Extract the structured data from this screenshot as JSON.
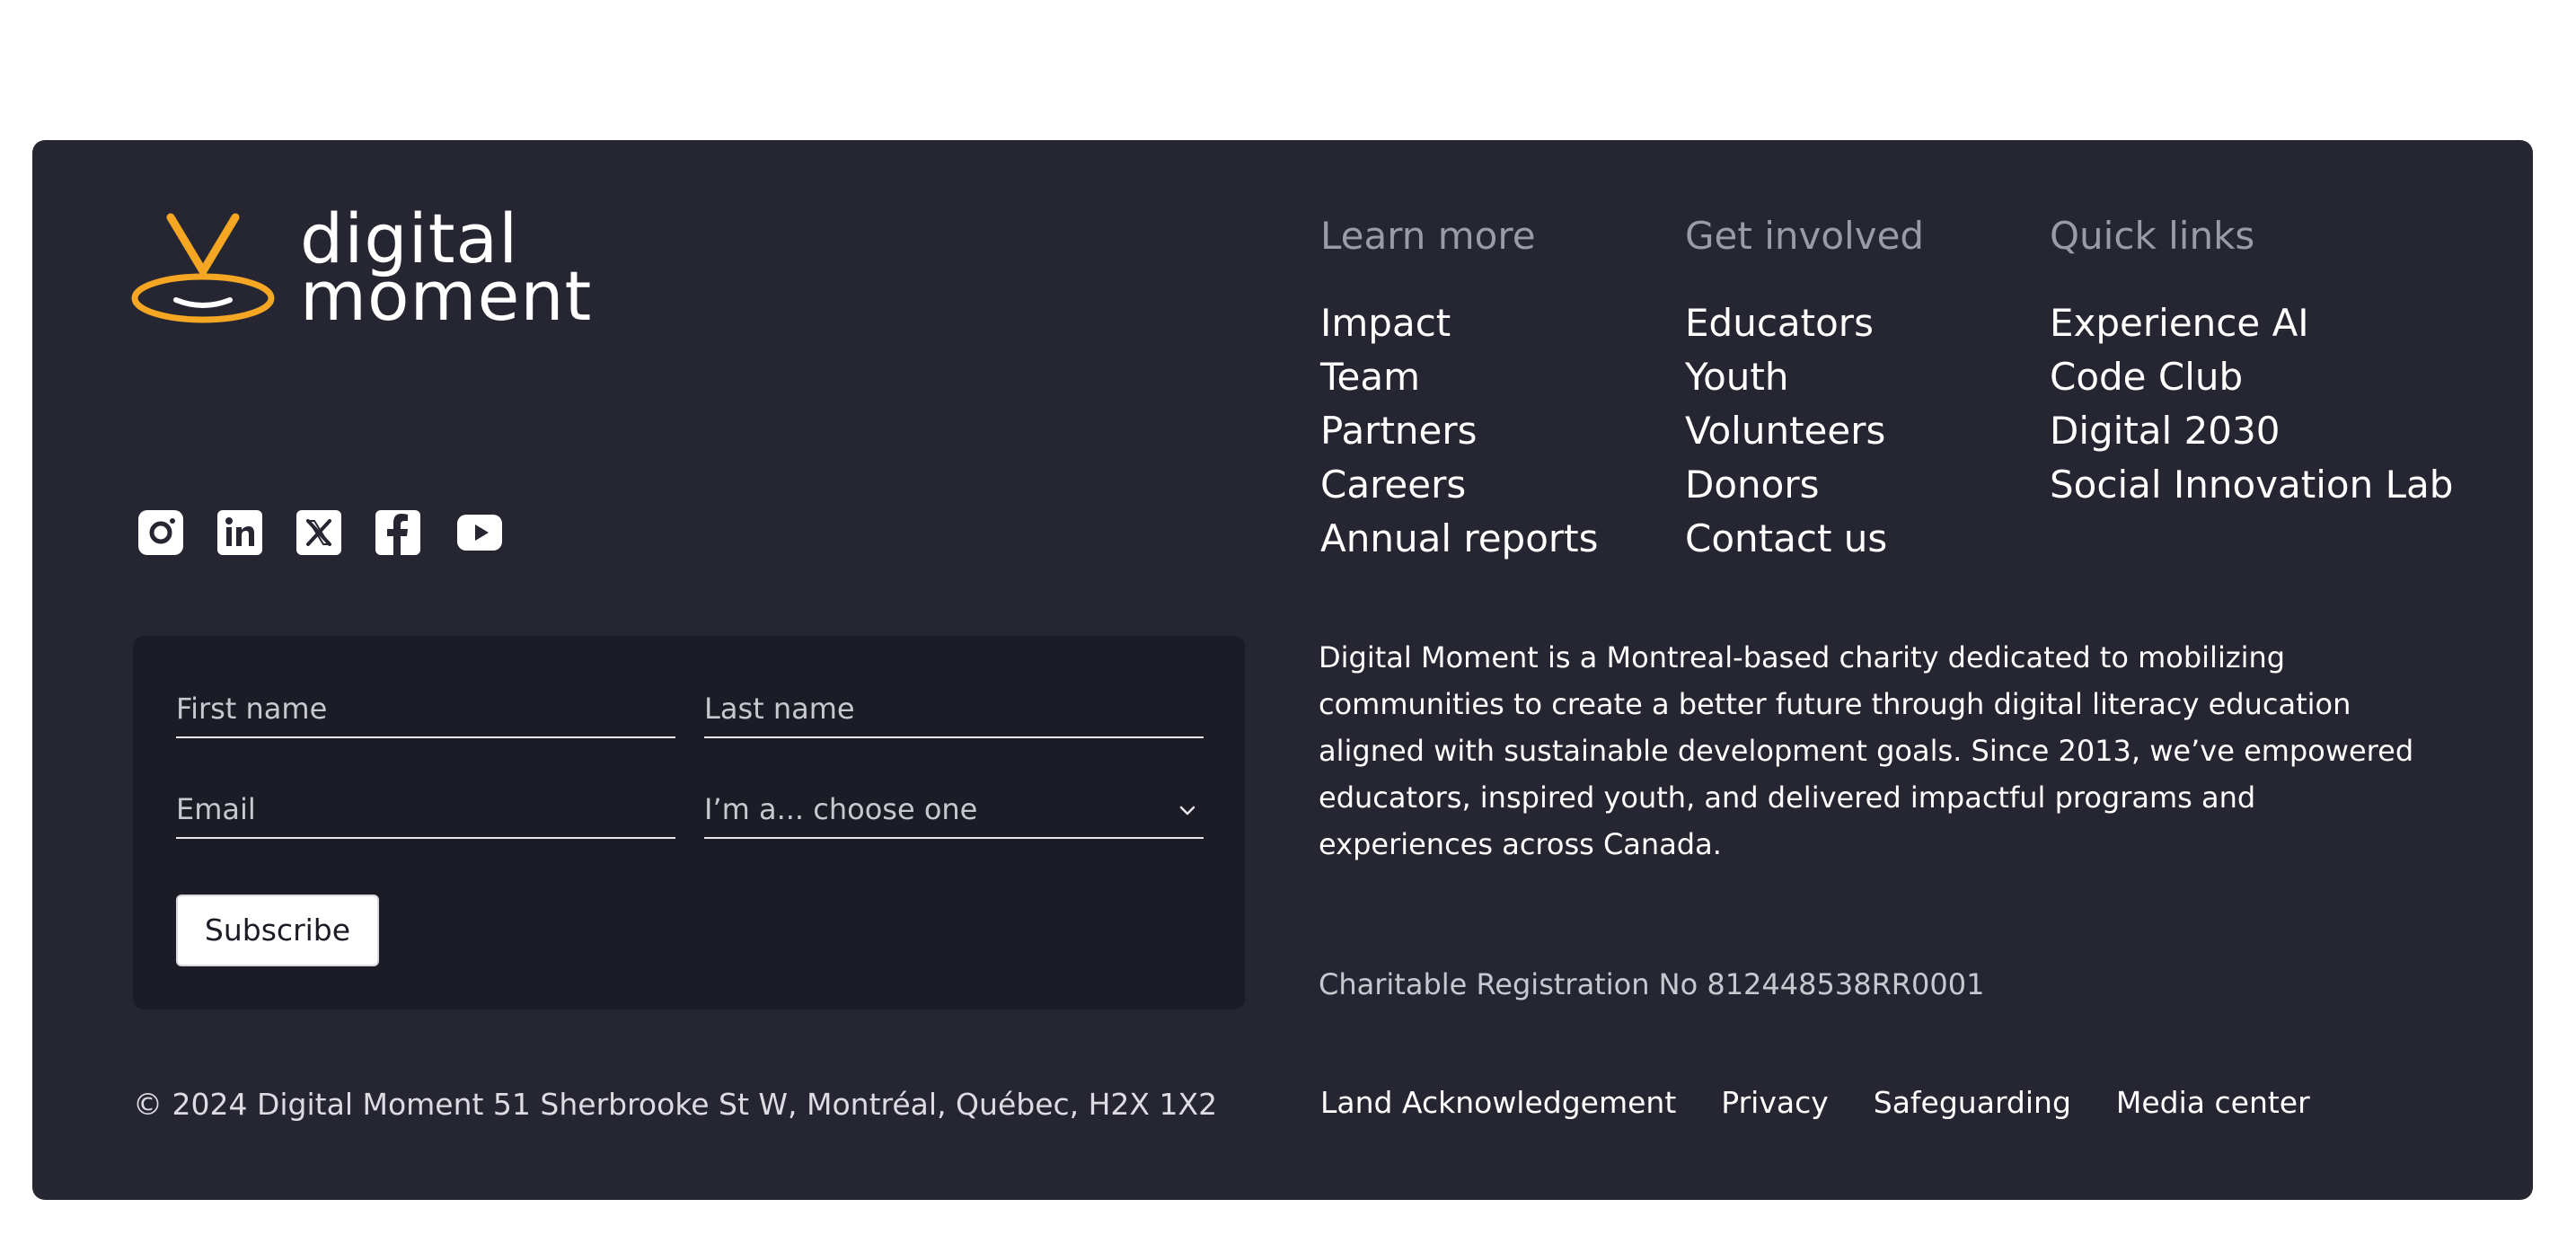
{
  "brand": {
    "logo_line1": "digital",
    "logo_line2": "moment",
    "accent_color": "#F5A623",
    "background_color": "#262632"
  },
  "social": [
    {
      "icon": "instagram-icon"
    },
    {
      "icon": "linkedin-icon"
    },
    {
      "icon": "x-twitter-icon"
    },
    {
      "icon": "facebook-icon"
    },
    {
      "icon": "youtube-icon"
    }
  ],
  "newsletter": {
    "first_name_placeholder": "First name",
    "last_name_placeholder": "Last name",
    "email_placeholder": "Email",
    "role_select_value": "I’m a... choose one",
    "subscribe_label": "Subscribe"
  },
  "columns": [
    {
      "heading": "Learn more",
      "links": [
        "Impact",
        "Team",
        "Partners",
        "Careers",
        "Annual reports"
      ]
    },
    {
      "heading": "Get involved",
      "links": [
        "Educators",
        "Youth",
        "Volunteers",
        "Donors",
        "Contact us"
      ]
    },
    {
      "heading": "Quick links",
      "links": [
        "Experience AI",
        "Code Club",
        "Digital 2030",
        "Social Innovation Lab"
      ]
    }
  ],
  "description": "Digital Moment is a Montreal-based charity dedicated to mobilizing communities to create a better future through digital literacy education aligned with sustainable development goals. Since 2013, we’ve empowered educators, inspired youth, and delivered impactful programs and experiences across Canada.",
  "registration": "Charitable Registration No 812448538RR0001",
  "copyright": "© 2024 Digital Moment 51 Sherbrooke St W, Montréal, Québec, H2X 1X2",
  "bottom_links": [
    "Land Acknowledgement",
    "Privacy",
    "Safeguarding",
    "Media center"
  ]
}
